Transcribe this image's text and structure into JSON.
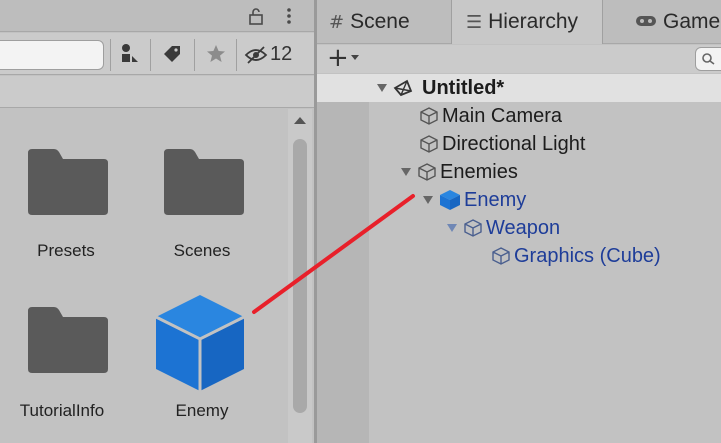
{
  "project": {
    "hidden_count": "12",
    "assets": [
      {
        "label": "Presets",
        "icon": "folder-icon"
      },
      {
        "label": "Scenes",
        "icon": "folder-icon"
      },
      {
        "label": "TutorialInfo",
        "icon": "folder-icon"
      },
      {
        "label": "Enemy",
        "icon": "prefab-cube-icon"
      }
    ]
  },
  "hierarchy": {
    "tabs": [
      {
        "label": "Scene",
        "icon": "grid-icon"
      },
      {
        "label": "Hierarchy",
        "icon": "list-icon"
      },
      {
        "label": "Game",
        "icon": "gamepad-icon"
      }
    ],
    "scene_name": "Untitled*",
    "items": [
      {
        "label": "Main Camera",
        "depth": 1
      },
      {
        "label": "Directional Light",
        "depth": 1
      },
      {
        "label": "Enemies",
        "depth": 1
      },
      {
        "label": "Enemy",
        "depth": 2
      },
      {
        "label": "Weapon",
        "depth": 3
      },
      {
        "label": "Graphics (Cube)",
        "depth": 4
      }
    ]
  },
  "colors": {
    "prefab_blue": "#1e73d8",
    "prefab_text": "#1e3d99",
    "connector_red": "#e8202a",
    "panel_bg": "#c2c2c2"
  }
}
